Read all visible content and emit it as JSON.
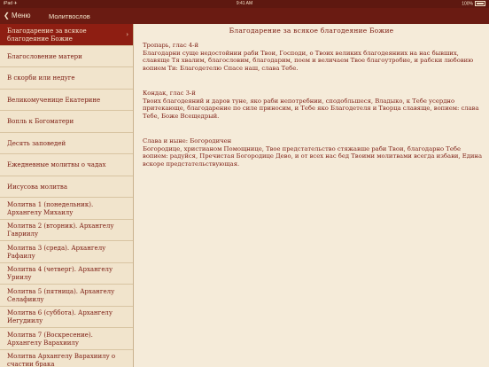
{
  "status": {
    "left": "iPad ✈",
    "time": "9:41 AM",
    "battery": "100%"
  },
  "nav": {
    "back_label": "Меню",
    "title": "Молитвослов"
  },
  "sidebar": {
    "items": [
      {
        "label": "Благодарение за всякое благодеяние Божие",
        "selected": true
      },
      {
        "label": "Благословение матери"
      },
      {
        "label": "В скорби или недуге"
      },
      {
        "label": "Великомученице Екатерине"
      },
      {
        "label": "Вопль к Богоматери"
      },
      {
        "label": "Десять заповедей"
      },
      {
        "label": "Ежедневные молитвы о чадах"
      },
      {
        "label": "Иисусова молитва"
      },
      {
        "label": "Молитва 1 (понедельник). Архангелу Михаилу"
      },
      {
        "label": "Молитва 2 (вторник). Архангелу Гавриилу"
      },
      {
        "label": "Молитва 3 (среда). Архангелу Рафаилу"
      },
      {
        "label": "Молитва 4 (четверг). Архангелу Уриилу"
      },
      {
        "label": "Молитва 5 (пятница). Архангелу Селафиилу"
      },
      {
        "label": "Молитва 6 (суббота). Архангелу Иегудиилу"
      },
      {
        "label": "Молитва 7 (Воскресение). Архангелу Варахиилу"
      },
      {
        "label": "Молитва Архангелу Варахиилу о счастии брака"
      }
    ]
  },
  "content": {
    "title": "Благодарение за всякое благодеяние Божие",
    "blocks": [
      {
        "heading": "Тропарь, глас 4-й",
        "text": "Благодарни суще недостойнии раби Твои, Господи, о Твоих великих благодеяниих на нас бывших, славяще Тя хвалим, благословим, благодарим, поем и величаем Твое благоутробие, и рабски любовию вопием Ти: Благодетелю Спасе наш, слава Тебе."
      },
      {
        "heading": "Кондак, глас 3-й",
        "text": "Твоих благодеяний и даров туне, яко раби непотребнии, сподобльшеся, Владыко, к Тебе усердно притекающе, благодарение по силе приносим, и Тебе яко Благодетеля и Творца славяще, вопием: слава Тебе, Боже Всещедрый."
      },
      {
        "heading": "Слава и ныне: Богородичен",
        "text": "Богородице, христианом Помощнице, Твое предстательство стяжавше раби Твои, благодарно Тебе вопием: радуйся, Пречистая Богородице Дево, и от всех нас бед Твоими молитвами всегда избави, Едина вскоре предстательствующая."
      }
    ]
  }
}
